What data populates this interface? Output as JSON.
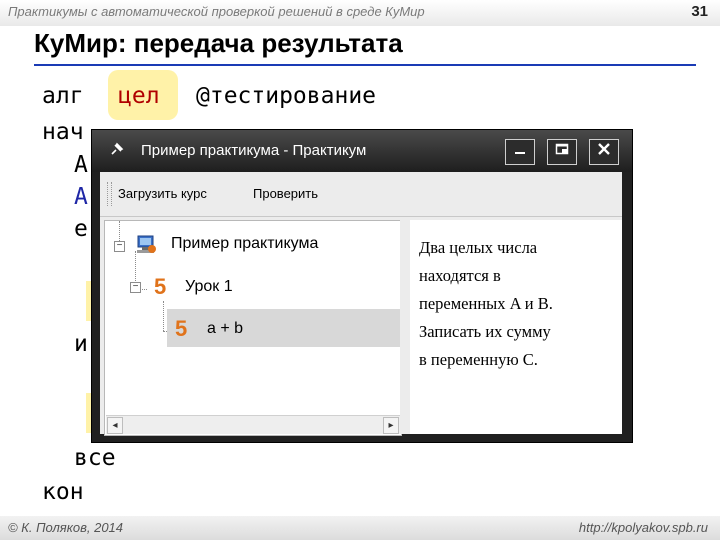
{
  "slide": {
    "header_text": "Практикумы с автоматической проверкой решений в среде КуМир",
    "page_number": "31",
    "title": "КуМир: передача результата",
    "footer_left": "© К. Поляков, 2014",
    "footer_right": "http://kpolyakov.spb.ru"
  },
  "code": {
    "alg": "алг",
    "cel": "цел",
    "testing": "@тестирование",
    "nach": "нач",
    "a1": "A",
    "a2": "A",
    "e": "е",
    "i": "и",
    "vse": "все",
    "kon": "кон"
  },
  "window": {
    "title": "Пример практикума - Практикум",
    "buttons": {
      "minimize": "—",
      "maximize": "□",
      "close": "✕"
    },
    "toolbar": {
      "load_course": "Загрузить курс",
      "check": "Проверить"
    },
    "tree": {
      "root_label": "Пример практикума",
      "lesson_label": "Урок 1",
      "task_label": "a + b",
      "lesson_icon": "5",
      "task_icon": "5"
    },
    "description": "Два целых числа\nнаходятся в\nпеременных A и B.\nЗаписать их сумму\nв переменную C."
  },
  "colors": {
    "title_rule": "#1a3bb5",
    "highlight": "#fff2a8",
    "keyword_red": "#b00000",
    "keyword_blue": "#1f27a6",
    "window_chrome": "#1e1e1e",
    "icon_orange": "#e0731b"
  }
}
